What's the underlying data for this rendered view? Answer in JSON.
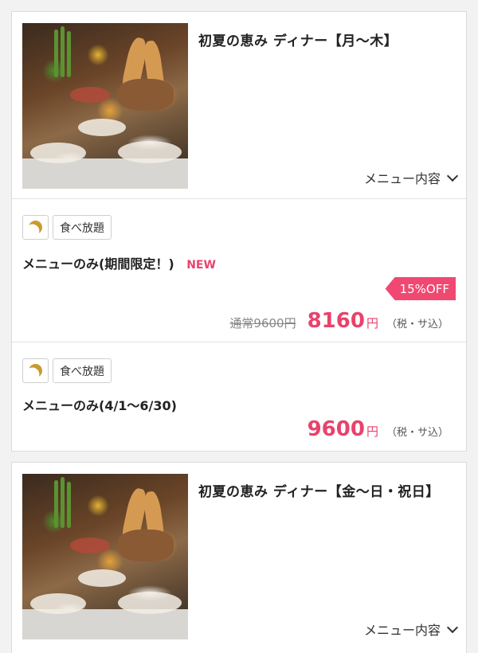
{
  "cards": [
    {
      "title": "初夏の恵み ディナー【月〜木】",
      "menu_toggle": "メニュー内容",
      "plans": [
        {
          "tag_icon": "moon-icon",
          "tag": "食べ放題",
          "name": "メニューのみ(期間限定！)",
          "badge": "NEW",
          "discount": "15%OFF",
          "old_price": "通常9600円",
          "price": "8160",
          "yen": "円",
          "tax": "（税・サ込）"
        },
        {
          "tag_icon": "moon-icon",
          "tag": "食べ放題",
          "name": "メニューのみ(4/1〜6/30)",
          "price": "9600",
          "yen": "円",
          "tax": "（税・サ込）"
        }
      ]
    },
    {
      "title": "初夏の恵み ディナー【金〜日・祝日】",
      "menu_toggle": "メニュー内容"
    }
  ],
  "colors": {
    "accent": "#e8436d",
    "badge_bg": "#f04870",
    "moon": "#c99a2e"
  }
}
